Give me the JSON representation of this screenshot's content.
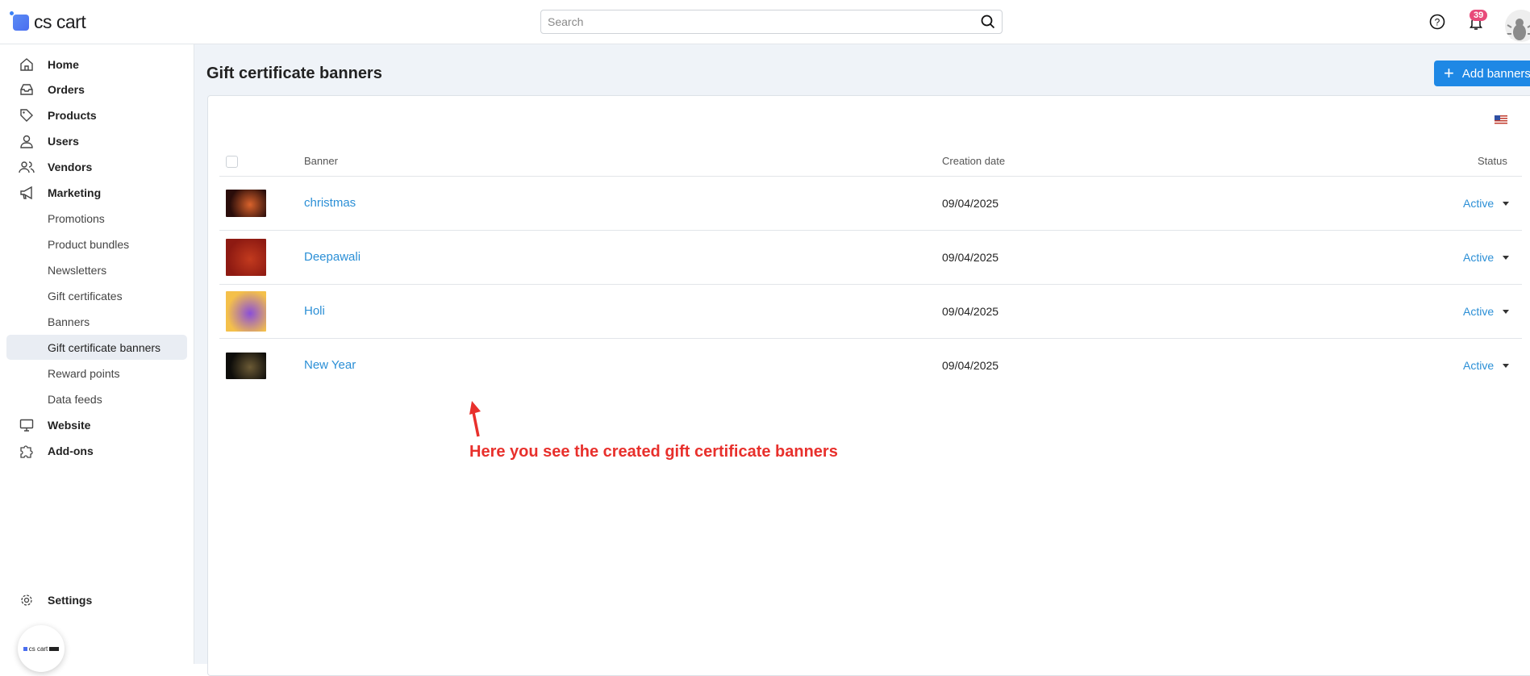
{
  "header": {
    "logo": "cs cart",
    "search_placeholder": "Search",
    "notification_count": "39"
  },
  "sidebar": {
    "items": [
      {
        "label": "Home",
        "icon": "home-icon"
      },
      {
        "label": "Orders",
        "icon": "inbox-icon"
      },
      {
        "label": "Products",
        "icon": "tag-icon"
      },
      {
        "label": "Users",
        "icon": "user-icon"
      },
      {
        "label": "Vendors",
        "icon": "users-icon"
      },
      {
        "label": "Marketing",
        "icon": "megaphone-icon"
      }
    ],
    "marketing_sub": [
      "Promotions",
      "Product bundles",
      "Newsletters",
      "Gift certificates",
      "Banners",
      "Gift certificate banners",
      "Reward points",
      "Data feeds"
    ],
    "bottom_items": [
      {
        "label": "Website",
        "icon": "monitor-icon"
      },
      {
        "label": "Add-ons",
        "icon": "puzzle-icon"
      }
    ],
    "settings": "Settings",
    "mini_logo": "cs cart"
  },
  "page": {
    "title": "Gift certificate banners",
    "add_button": "Add banners"
  },
  "table": {
    "headers": {
      "banner": "Banner",
      "date": "Creation date",
      "status": "Status"
    },
    "rows": [
      {
        "name": "christmas",
        "date": "09/04/2025",
        "status": "Active",
        "colors": [
          "#2a0d0a",
          "#d9622b"
        ]
      },
      {
        "name": "Deepawali",
        "date": "09/04/2025",
        "status": "Active",
        "colors": [
          "#8e1a12",
          "#c23a1e"
        ]
      },
      {
        "name": "Holi",
        "date": "09/04/2025",
        "status": "Active",
        "colors": [
          "#f4c04a",
          "#8a4fd8"
        ]
      },
      {
        "name": "New Year",
        "date": "09/04/2025",
        "status": "Active",
        "colors": [
          "#0e0d0a",
          "#6b5a35"
        ]
      }
    ]
  },
  "annotation": "Here you see the created gift certificate banners",
  "colors": {
    "accent": "#1e88e5",
    "link": "#2b8fd6",
    "annotation": "#e8302c"
  }
}
